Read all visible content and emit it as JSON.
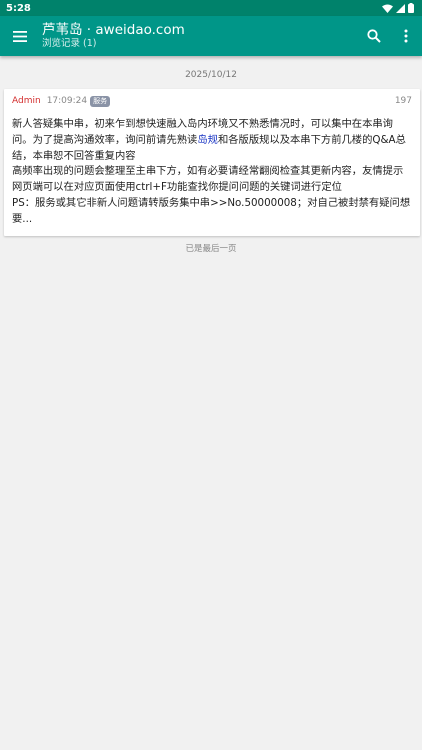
{
  "status_bar": {
    "time": "5:28"
  },
  "app_bar": {
    "title": "芦苇岛 · aweidao.com",
    "subtitle": "浏览记录 (1)",
    "icons": {
      "menu": "menu-icon",
      "search": "search-icon",
      "more": "more-vert-icon"
    }
  },
  "feed": {
    "date_header": "2025/10/12",
    "posts": [
      {
        "author": "Admin",
        "time": "17:09:24",
        "tag": "服务",
        "reply_count": "197",
        "content_part1": "新人答疑集中串，初来乍到想快速融入岛内环境又不熟悉情况时，可以集中在本串询问。为了提高沟通效率，询问前请先熟读",
        "content_link": "岛规",
        "content_part2": "和各版版规以及本串下方前几楼的Q&A总结，本串恕不回答重复内容\n高频率出现的问题会整理至主串下方，如有必要请经常翻阅检查其更新内容，友情提示网页端可以在对应页面使用ctrl+F功能查找你提问问题的关键词进行定位\nPS：服务或其它非新人问题请转版务集中串>>No.50000008；对自己被封禁有疑问想要..."
      }
    ],
    "end_label": "已是最后一页"
  },
  "colors": {
    "status_bar": "#00826b",
    "app_bar": "#009688",
    "author": "#d32f2f",
    "link": "#1a35c4",
    "tag": "#8a93a6"
  }
}
